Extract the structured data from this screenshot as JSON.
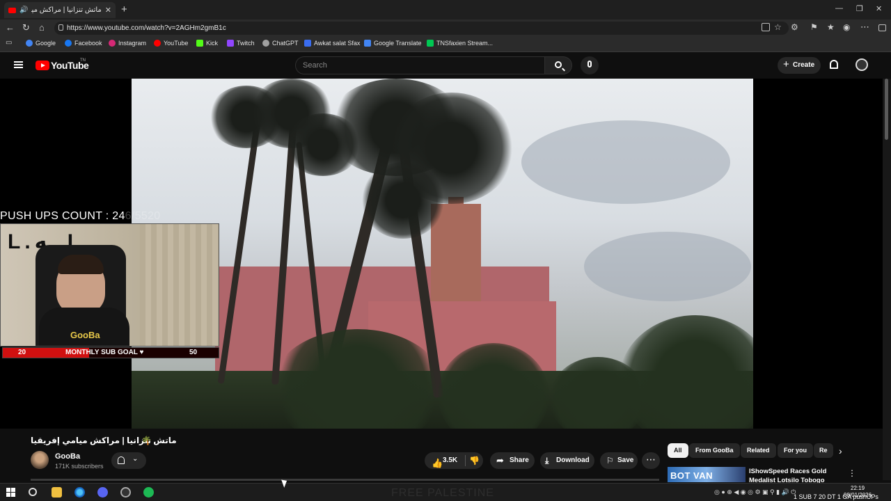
{
  "browser": {
    "tab_title": "ماتش تنزانيا | مراكش ميامي إفريقيا",
    "tab_close": "✕",
    "new_tab": "+",
    "window_controls": [
      "—",
      "❐",
      "✕"
    ],
    "url": "https://www.youtube.com/watch?v=2AGHm2gmB1c",
    "bookmarks": [
      "Google",
      "Facebook",
      "Instagram",
      "YouTube",
      "Kick",
      "Twitch",
      "ChatGPT",
      "Awkat salat Sfax",
      "Google Translate",
      "TNSfaxien Stream..."
    ],
    "bookmark_colors": [
      "#4285f4",
      "#1877f2",
      "#d62976",
      "#ff0000",
      "#53fc18",
      "#9146ff",
      "#a0a0a0",
      "#3a6df0",
      "#4285f4",
      "#00c853"
    ]
  },
  "youtube": {
    "logo_text": "YouTube",
    "logo_sup": "TN",
    "search_placeholder": "Search",
    "create_label": "Create"
  },
  "stream_overlay": {
    "pushups_label": "PUSH UPS COUNT : 24",
    "pushups_ghost": "6/5520",
    "goal_current": "20",
    "goal_label": "MONTHLY SUB GOAL ♥",
    "goal_target": "50",
    "goal_fraction": 0.4,
    "webcam_wall_text": "L.ــه.L",
    "shirt_logo": "GooBa"
  },
  "video": {
    "title": "ماتش تنزانيا | مراكش ميامي إفريقيا",
    "title_emoji": "🌴",
    "channel_name": "GooBa",
    "subscribers": "171K subscribers",
    "likes": "3.5K",
    "share_label": "Share",
    "download_label": "Download",
    "save_label": "Save",
    "more_label": "⋯"
  },
  "sidebar": {
    "chips": [
      "All",
      "From GooBa",
      "Related",
      "For you",
      "Re"
    ],
    "active_chip": "All",
    "next_arrow": "›",
    "rec_title": "IShowSpeed Races Gold Medalist Lotsilo Tobogo",
    "rec_thumb_text": "BOT VAN",
    "rec_menu": "⋮"
  },
  "taskbar": {
    "watermark": "FREE PALESTINE",
    "time": "22:19",
    "date": "08/01/2026",
    "bottom_overlay": "1 SUB 7 20 DT 1 GA pushUPs"
  }
}
